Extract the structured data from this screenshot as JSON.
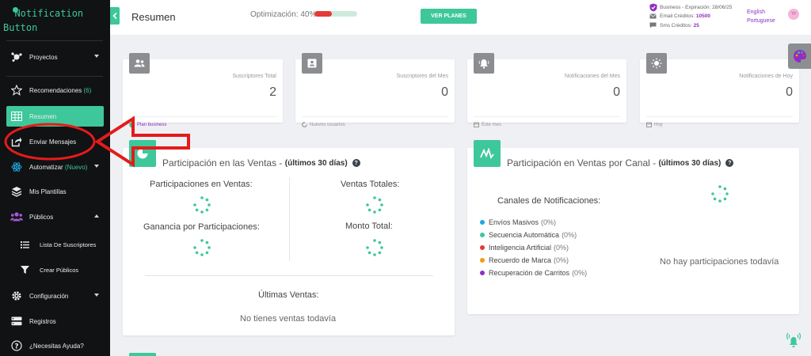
{
  "brand": {
    "name_line1": "  Notification",
    "name_line2": "Button",
    "color": "#3ec79b"
  },
  "sidebar": {
    "items": [
      {
        "label": "Proyectos",
        "icon": "network-icon"
      },
      {
        "label": "Recomendaciones",
        "badge": "(6)",
        "icon": "star-icon"
      },
      {
        "label": "Resumen",
        "icon": "grid-icon",
        "active": true
      },
      {
        "label": "Enviar Mensajes",
        "icon": "share-icon"
      },
      {
        "label": "Automatizar",
        "badge": "(Nuevo)",
        "icon": "atom-icon"
      },
      {
        "label": "Mis Plantillas",
        "icon": "layers-icon"
      },
      {
        "label": "Públicos",
        "icon": "users-icon"
      },
      {
        "label": "Lista De Suscriptores",
        "icon": "list-icon"
      },
      {
        "label": "Crear Públicos",
        "icon": "funnel-icon"
      },
      {
        "label": "Configuración",
        "icon": "gear-icon"
      },
      {
        "label": "Registros",
        "icon": "server-icon"
      },
      {
        "label": "¿Necesitas Ayuda?",
        "icon": "help-icon"
      }
    ]
  },
  "header": {
    "title": "Resumen",
    "optimization_label": "Optimización: 40%",
    "optimization_value": 0.4,
    "plans_button": "VER PLANES",
    "plan": "Business - Expiración: 28/06/25",
    "email_label": "Email Créditos:",
    "email_value": "10500",
    "sms_label": "Sms Créditos:",
    "sms_value": "25",
    "lang_1": "English",
    "lang_2": "Portuguese",
    "avatar": "TP"
  },
  "stats": [
    {
      "title": "Suscriptores Total",
      "value": "2",
      "foot": "Plan business",
      "icon": "users-icon"
    },
    {
      "title": "Suscriptores del Mes",
      "value": "0",
      "foot": "Nuevos usuarios",
      "icon": "contact-card-icon"
    },
    {
      "title": "Notificaciones del Mes",
      "value": "0",
      "foot": "Este mes",
      "icon": "bell-icon"
    },
    {
      "title": "Notificaciones de Hoy",
      "value": "0",
      "foot": "Hoy",
      "icon": "sun-icon"
    }
  ],
  "sales_card": {
    "title": "Participación en las Ventas -",
    "period": "(últimos 30 días)",
    "participaciones": "Participaciones en Ventas:",
    "ventas_totales": "Ventas Totales:",
    "ganancia": "Ganancia por Participaciones:",
    "monto_total": "Monto Total:",
    "ultimas": "Últimas Ventas:",
    "empty": "No tienes ventas todavía"
  },
  "channel_card": {
    "title": "Participación en Ventas por Canal -",
    "period": "(últimos 30 días)",
    "channels_title": "Canales de Notificaciones:",
    "channels": [
      {
        "name": "Envíos Masivos",
        "pct": "(0%)",
        "color": "#1ea7e1"
      },
      {
        "name": "Secuencia Automática",
        "pct": "(0%)",
        "color": "#3ec79b"
      },
      {
        "name": "Inteligencia Artificial",
        "pct": "(0%)",
        "color": "#e53935"
      },
      {
        "name": "Recuerdo de Marca",
        "pct": "(0%)",
        "color": "#f39c12"
      },
      {
        "name": "Recuperación de Carritos",
        "pct": "(0%)",
        "color": "#8e2ec4"
      }
    ],
    "empty": "No hay participaciones todavía"
  },
  "colors": {
    "accent": "#3ec79b",
    "purple": "#8e2ec4",
    "annotation_red": "#e41b1b",
    "sidebar_bg": "#101213"
  }
}
